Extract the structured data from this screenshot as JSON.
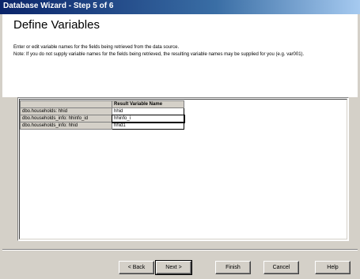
{
  "window": {
    "title": "Database Wizard - Step 5 of 6"
  },
  "header": {
    "heading": "Define Variables",
    "line1": "Enter or edit variable names for the fields being retrieved from the data source.",
    "line2": "Note: If you do not supply variable names for the fields being retrieved, the resulting variable names may be supplied for you (e.g. var001)."
  },
  "grid": {
    "column_header": "Result Variable Name",
    "rows": [
      {
        "field": "dbo.households: hhid",
        "name": "hhid"
      },
      {
        "field": "dbo.households_info: hhinfo_id",
        "name": "hhinfo_i"
      },
      {
        "field": "dbo.households_info: hhid",
        "name": "hhid1"
      }
    ]
  },
  "buttons": {
    "back": "< Back",
    "next": "Next >",
    "finish": "Finish",
    "cancel": "Cancel",
    "help": "Help"
  }
}
